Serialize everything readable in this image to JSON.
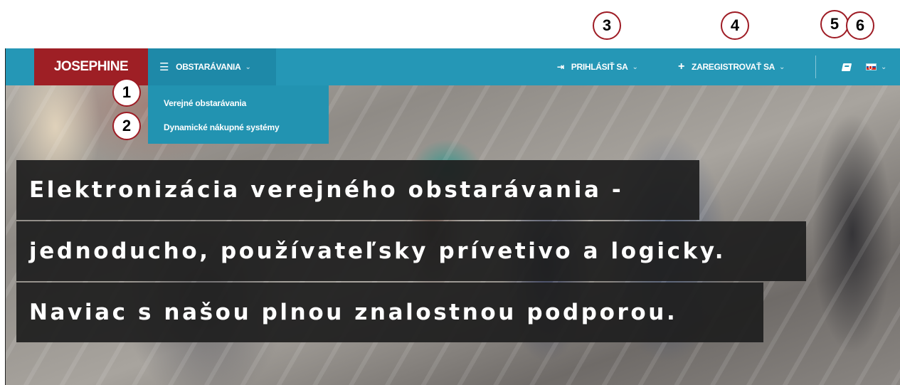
{
  "annotations": [
    "1",
    "2",
    "3",
    "4",
    "5",
    "6"
  ],
  "navbar": {
    "logo": "JOSEPHINE",
    "obstaravania_label": "OBSTARÁVANIA",
    "login_label": "PRIHLÁSIŤ SA",
    "register_label": "ZAREGISTROVAŤ SA",
    "language": "Slovak flag"
  },
  "dropdown": {
    "items": [
      "Verejné obstarávania",
      "Dynamické nákupné systémy"
    ]
  },
  "hero": {
    "lines": [
      "Elektronizácia verejného obstarávania -",
      "jednoducho, používateľsky prívetivo a logicky.",
      "Naviac s našou plnou znalostnou podporou."
    ]
  },
  "colors": {
    "navbar": "#2597b6",
    "logo_bg": "#9e1f25",
    "annotation_border": "#9e1b24"
  }
}
